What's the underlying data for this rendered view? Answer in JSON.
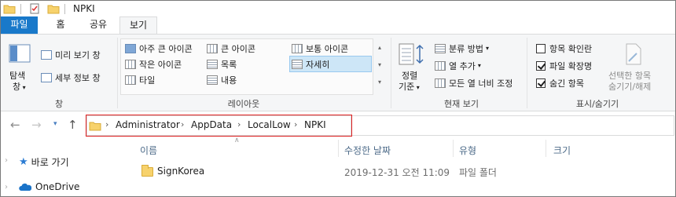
{
  "window": {
    "title": "NPKI"
  },
  "ribbon_tabs": {
    "file": "파일",
    "home": "홈",
    "share": "공유",
    "view": "보기"
  },
  "panes_group": {
    "label": "창",
    "nav_pane": "탐색\n창",
    "nav_pane_line1": "탐색",
    "nav_pane_line2": "창",
    "preview_pane": "미리 보기 창",
    "details_pane": "세부 정보 창"
  },
  "layout_group": {
    "label": "레이아웃",
    "items": {
      "extra_large": "아주 큰 아이콘",
      "large": "큰 아이콘",
      "medium": "보통 아이콘",
      "small": "작은 아이콘",
      "list": "목록",
      "details": "자세히",
      "tiles": "타일",
      "content": "내용"
    },
    "selected": "details"
  },
  "current_view_group": {
    "label": "현재 보기",
    "sort_line1": "정렬",
    "sort_line2": "기준",
    "group_by": "분류 방법",
    "add_columns": "열 추가",
    "size_columns": "모든 열 너비 조정"
  },
  "show_hide_group": {
    "label": "표시/숨기기",
    "item_checkboxes": "항목 확인란",
    "item_checkboxes_checked": false,
    "file_extensions": "파일 확장명",
    "file_extensions_checked": true,
    "hidden_items": "숨긴 항목",
    "hidden_items_checked": true,
    "hide_selected_line1": "선택한 항목",
    "hide_selected_line2": "숨기기/해제"
  },
  "address": {
    "crumbs": [
      "Administrator",
      "AppData",
      "LocalLow",
      "NPKI"
    ]
  },
  "columns": {
    "name": "이름",
    "date": "수정한 날짜",
    "type": "유형",
    "size": "크기"
  },
  "nav_pane": {
    "quick_access": "바로 가기",
    "onedrive": "OneDrive"
  },
  "files": [
    {
      "name": "SignKorea",
      "date": "2019-12-31 오전 11:09",
      "type": "파일 폴더",
      "size": ""
    }
  ],
  "colors": {
    "file_tab": "#1979ca",
    "highlight_border": "#e02020",
    "selected_bg": "#cde6f7"
  }
}
